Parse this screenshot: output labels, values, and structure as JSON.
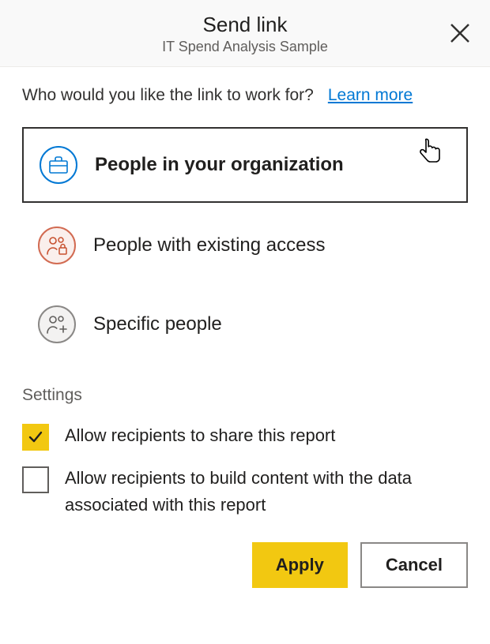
{
  "header": {
    "title": "Send link",
    "subtitle": "IT Spend Analysis Sample"
  },
  "prompt": "Who would you like the link to work for?",
  "learn_more": "Learn more",
  "options": {
    "org": "People in your organization",
    "existing": "People with existing access",
    "specific": "Specific people"
  },
  "settings": {
    "heading": "Settings",
    "allow_share": "Allow recipients to share this report",
    "allow_build": "Allow recipients to build content with the data associated with this report"
  },
  "buttons": {
    "apply": "Apply",
    "cancel": "Cancel"
  }
}
